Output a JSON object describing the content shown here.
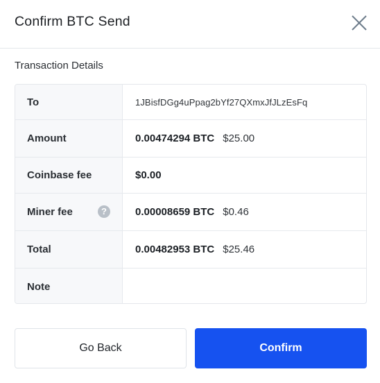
{
  "dialog": {
    "title": "Confirm BTC Send",
    "section_label": "Transaction Details"
  },
  "details": {
    "to": {
      "label": "To",
      "address": "1JBisfDGg4uPpag2bYf27QXmxJfJLzEsFq"
    },
    "amount": {
      "label": "Amount",
      "crypto": "0.00474294 BTC",
      "fiat": "$25.00"
    },
    "coinbase_fee": {
      "label": "Coinbase fee",
      "value": "$0.00"
    },
    "miner_fee": {
      "label": "Miner fee",
      "help": "?",
      "crypto": "0.00008659 BTC",
      "fiat": "$0.46"
    },
    "total": {
      "label": "Total",
      "crypto": "0.00482953 BTC",
      "fiat": "$25.46"
    },
    "note": {
      "label": "Note",
      "value": ""
    }
  },
  "actions": {
    "back_label": "Go Back",
    "confirm_label": "Confirm"
  },
  "colors": {
    "accent": "#1652f0",
    "label_background": "#f7f8fa",
    "border": "#e4e7eb"
  },
  "icons": {
    "close": "close-icon",
    "help": "help-icon"
  }
}
